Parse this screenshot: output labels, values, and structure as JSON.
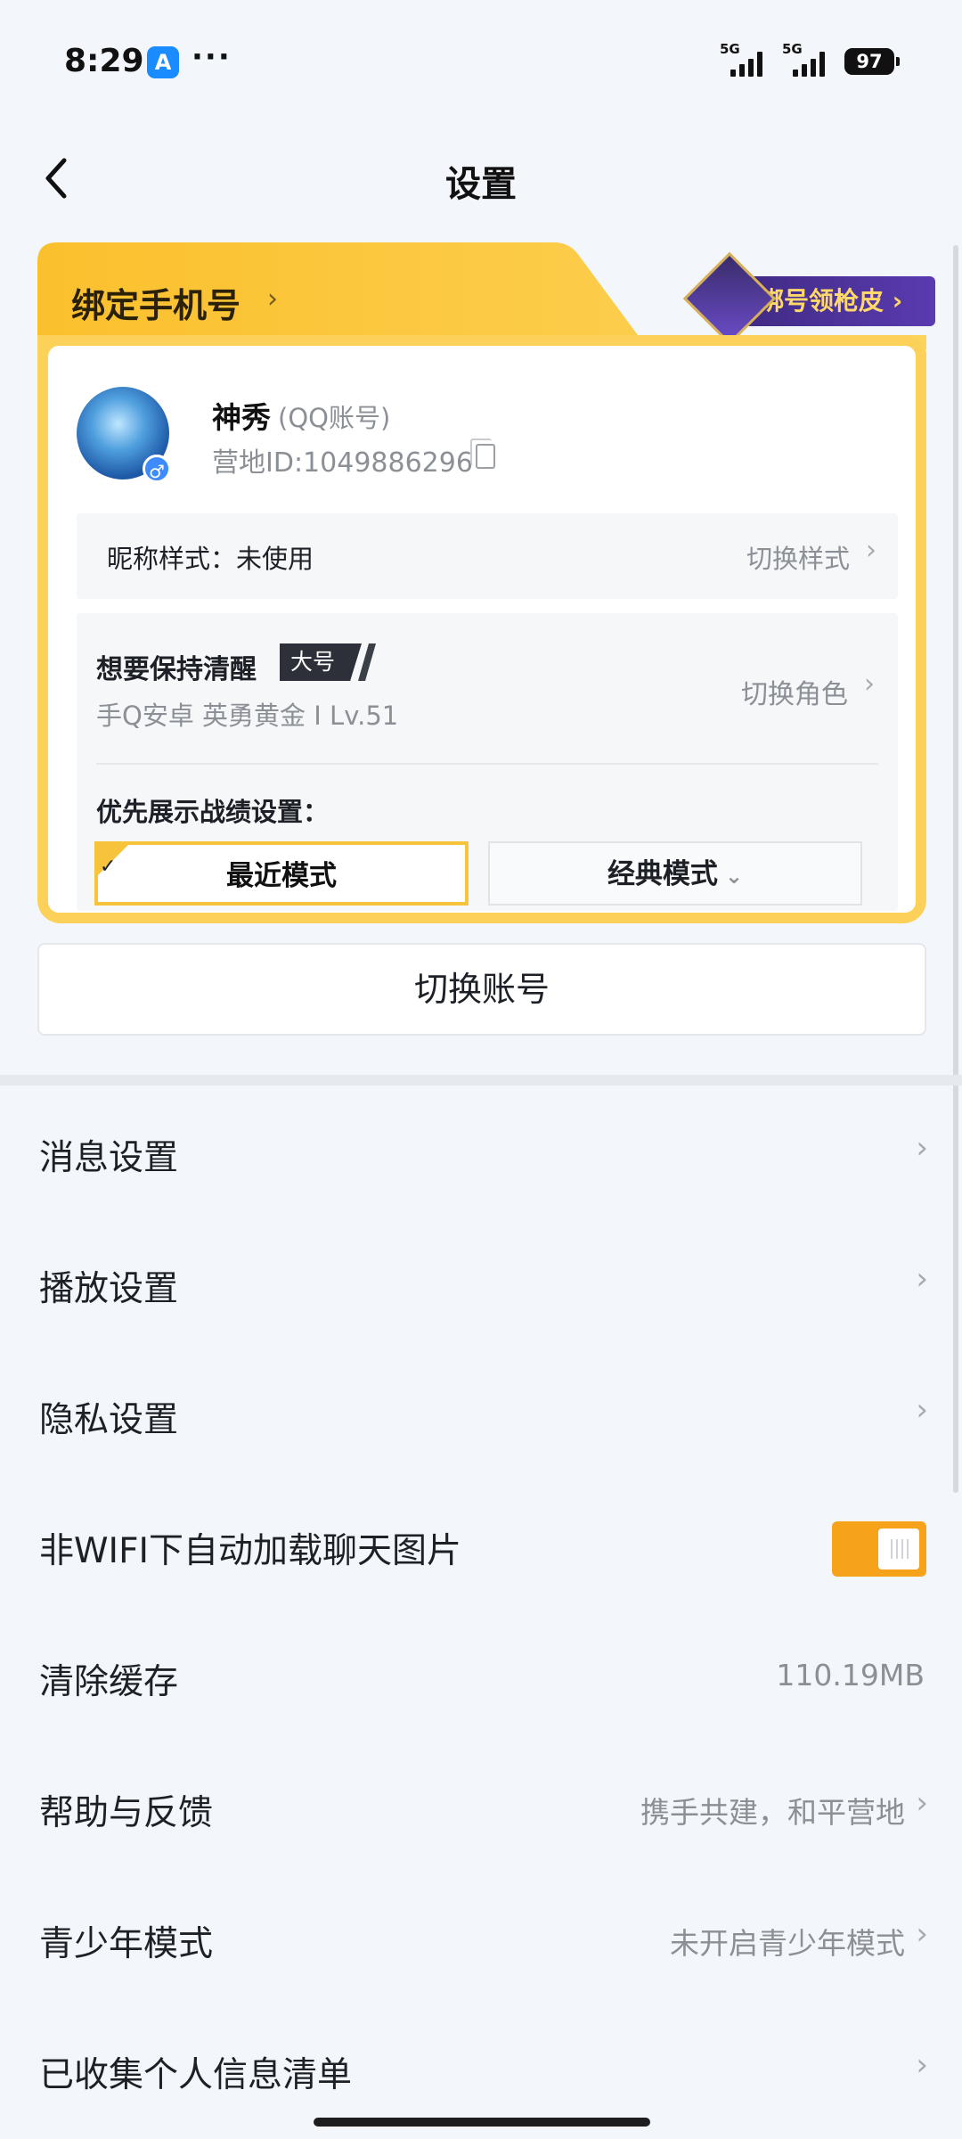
{
  "status_bar": {
    "time": "8:29",
    "more": "···",
    "network_label_1": "5G",
    "network_label_2": "5G",
    "battery": "97"
  },
  "header": {
    "title": "设置"
  },
  "account_card": {
    "bind_phone_label": "绑定手机号",
    "bind_chevron": "›",
    "promo_label": "绑号领枪皮 ›",
    "nickname": "神秀",
    "account_type": "(QQ账号)",
    "camp_id": "营地ID:1049886296",
    "gender_symbol": "♂",
    "nickname_style_label": "昵称样式：未使用",
    "switch_style": "切换样式",
    "role_name": "想要保持清醒",
    "role_tag": "大号",
    "role_meta": "手Q安卓  英勇黄金 I   Lv.51",
    "switch_role": "切换角色",
    "pref_label": "优先展示战绩设置：",
    "mode_recent": "最近模式",
    "mode_classic": "经典模式",
    "mode_classic_dd": "⌄",
    "check": "✓"
  },
  "switch_account": "切换账号",
  "settings": [
    {
      "label": "消息设置",
      "value": "",
      "chevron": "›"
    },
    {
      "label": "播放设置",
      "value": "",
      "chevron": "›"
    },
    {
      "label": "隐私设置",
      "value": "",
      "chevron": "›"
    },
    {
      "label": "非WIFI下自动加载聊天图片",
      "toggle_on": true
    },
    {
      "label": "清除缓存",
      "value": "110.19MB"
    },
    {
      "label": "帮助与反馈",
      "value": "携手共建，和平营地",
      "chevron": "›"
    },
    {
      "label": "青少年模式",
      "value": "未开启青少年模式",
      "chevron": "›"
    },
    {
      "label": "已收集个人信息清单",
      "value": "",
      "chevron": "›"
    }
  ],
  "colors": {
    "accent": "#f7a21b",
    "card_yellow": "#fbd15a",
    "background": "#f3f6fa"
  }
}
